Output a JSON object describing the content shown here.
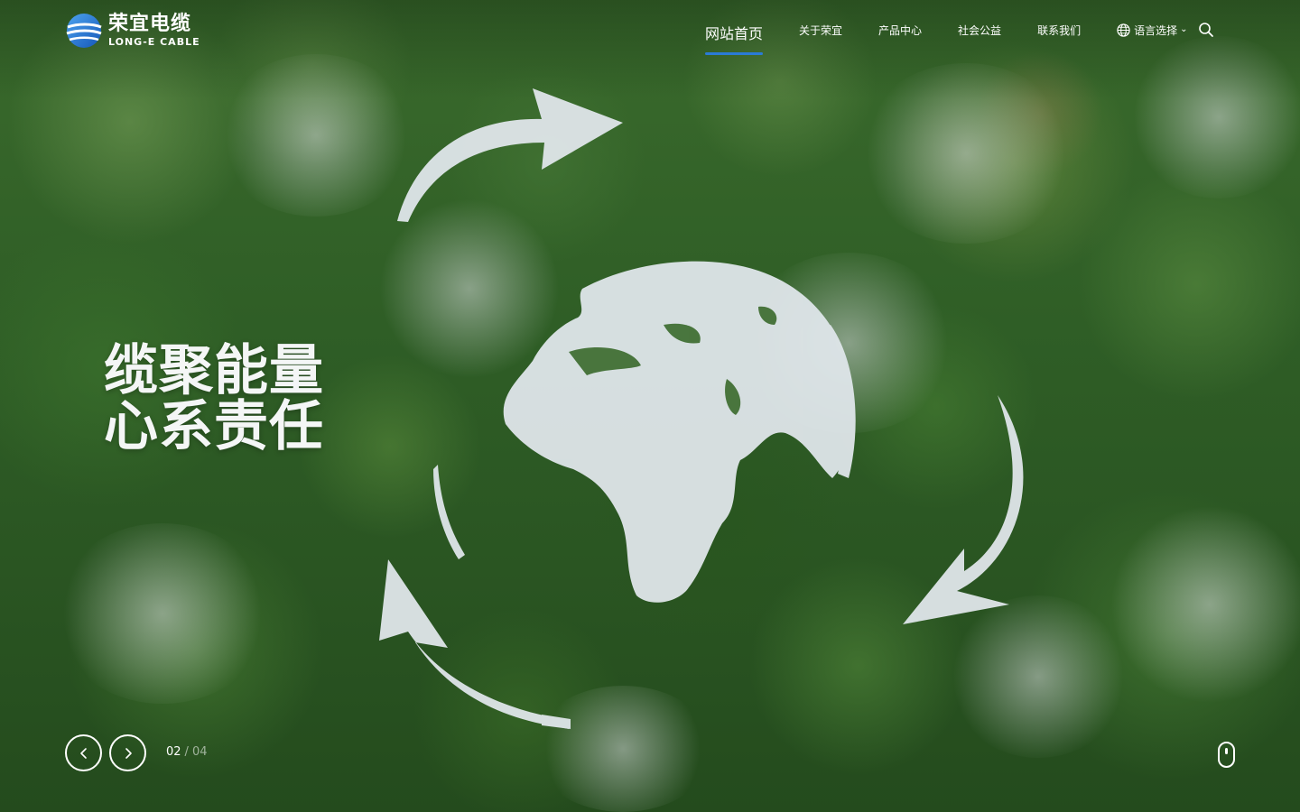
{
  "brand": {
    "name_cn": "荣宜电缆",
    "name_en": "LONG-E CABLE",
    "primary_color": "#1f6fd1"
  },
  "nav": {
    "items": [
      {
        "label": "网站首页",
        "active": true
      },
      {
        "label": "关于荣宜",
        "active": false
      },
      {
        "label": "产品中心",
        "active": false
      },
      {
        "label": "社会公益",
        "active": false
      },
      {
        "label": "联系我们",
        "active": false
      }
    ],
    "language_label": "语言选择",
    "language_icon": "globe-icon",
    "search_icon": "search-icon",
    "active_indicator_color": "#2a7bd6"
  },
  "hero": {
    "headline_line1": "缆聚能量",
    "headline_line2": "心系责任",
    "slide_current": "02",
    "slide_separator": "/",
    "slide_total": "04"
  },
  "controls": {
    "prev_icon": "chevron-left-icon",
    "next_icon": "chevron-right-icon",
    "scroll_icon": "mouse-scroll-icon"
  }
}
